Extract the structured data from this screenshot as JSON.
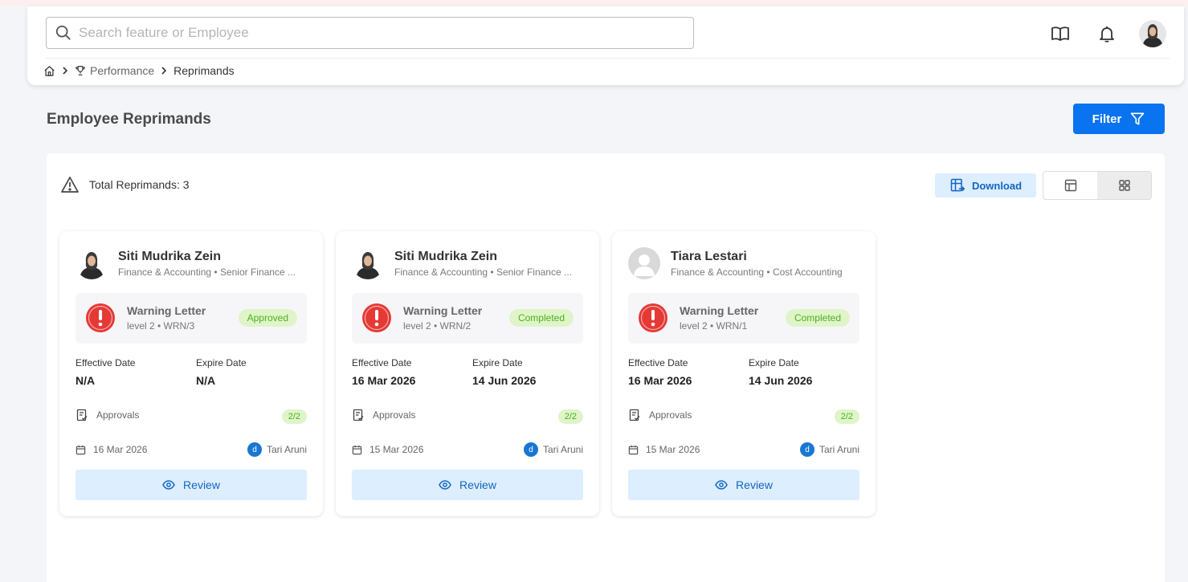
{
  "header": {
    "search_placeholder": "Search feature or Employee",
    "breadcrumb": {
      "performance": "Performance",
      "current": "Reprimands"
    }
  },
  "page": {
    "title": "Employee Reprimands",
    "filter_label": "Filter"
  },
  "toolbar": {
    "total_label": "Total Reprimands: 3",
    "download_label": "Download"
  },
  "colors": {
    "accent": "#0a73f0",
    "badge_bg": "#dff5c9",
    "badge_text": "#4caf1e",
    "warning": "#e53935"
  },
  "cards": [
    {
      "name": "Siti Mudrika Zein",
      "dept": "Finance & Accounting • Senior Finance ...",
      "avatar": "photo-avatar",
      "letter_title": "Warning Letter",
      "letter_sub": "level 2 • WRN/3",
      "status": "Approved",
      "effective_label": "Effective Date",
      "effective": "N/A",
      "expire_label": "Expire Date",
      "expire": "N/A",
      "approvals_label": "Approvals",
      "approvals_count": "2/2",
      "created": "16 Mar 2026",
      "author_initial": "d",
      "author": "Tari Aruni",
      "review_label": "Review"
    },
    {
      "name": "Siti Mudrika Zein",
      "dept": "Finance & Accounting • Senior Finance ...",
      "avatar": "photo-avatar",
      "letter_title": "Warning Letter",
      "letter_sub": "level 2 • WRN/2",
      "status": "Completed",
      "effective_label": "Effective Date",
      "effective": "16 Mar 2026",
      "expire_label": "Expire Date",
      "expire": "14 Jun 2026",
      "approvals_label": "Approvals",
      "approvals_count": "2/2",
      "created": "15 Mar 2026",
      "author_initial": "d",
      "author": "Tari Aruni",
      "review_label": "Review"
    },
    {
      "name": "Tiara Lestari",
      "dept": "Finance & Accounting • Cost Accounting",
      "avatar": "placeholder-avatar",
      "letter_title": "Warning Letter",
      "letter_sub": "level 2 • WRN/1",
      "status": "Completed",
      "effective_label": "Effective Date",
      "effective": "16 Mar 2026",
      "expire_label": "Expire Date",
      "expire": "14 Jun 2026",
      "approvals_label": "Approvals",
      "approvals_count": "2/2",
      "created": "15 Mar 2026",
      "author_initial": "d",
      "author": "Tari Aruni",
      "review_label": "Review"
    }
  ]
}
